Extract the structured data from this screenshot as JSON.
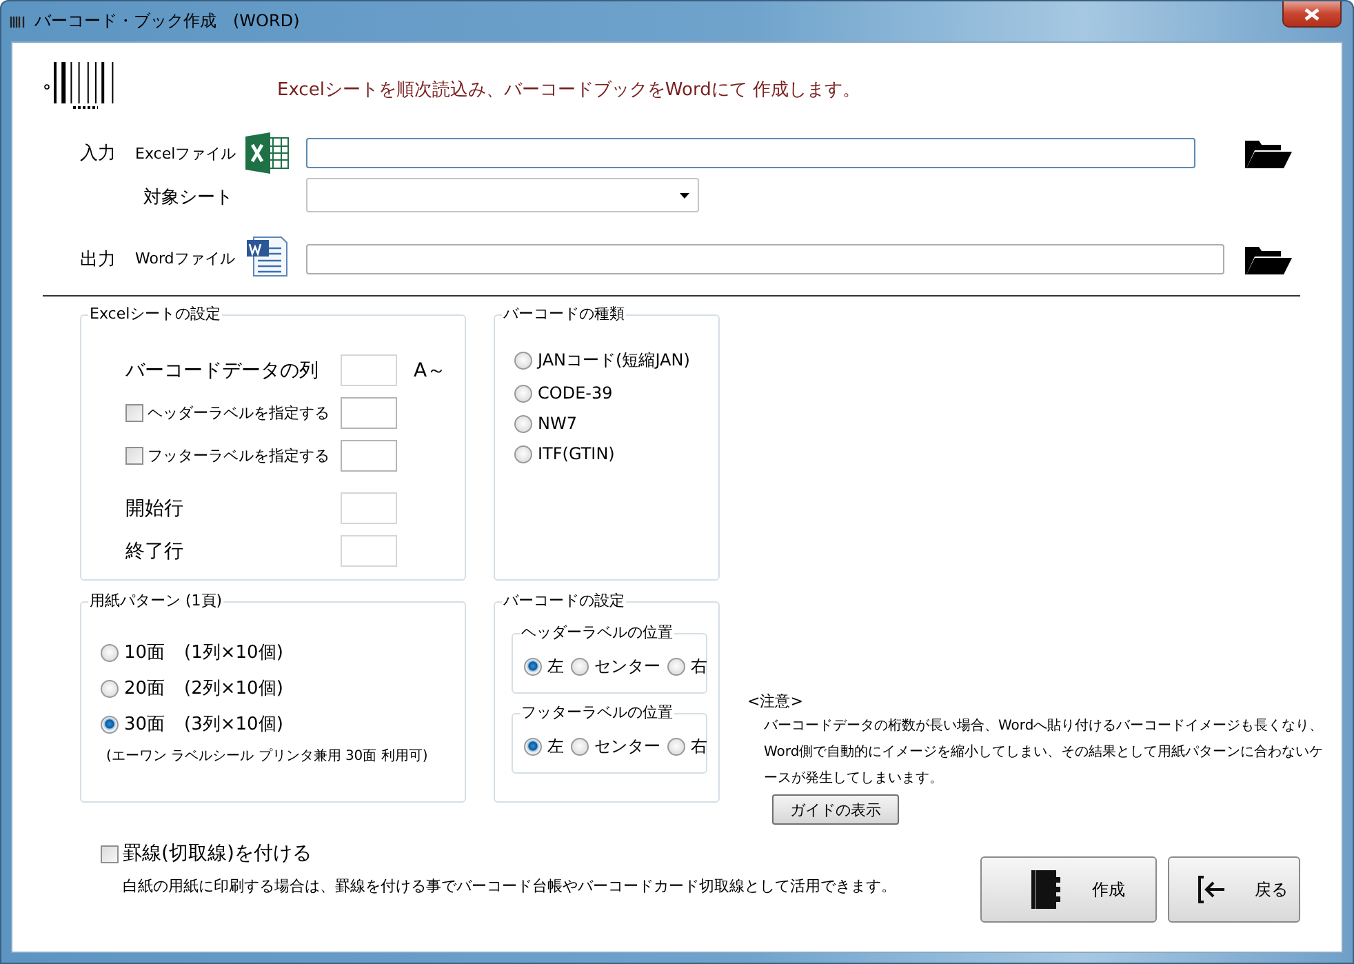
{
  "window": {
    "title": "バーコード・ブック作成　(WORD)"
  },
  "message": "Excelシートを順次読込み、バーコードブックをWordにて 作成します。",
  "input": {
    "label": "入力",
    "excel_file": {
      "label": "Excelファイル"
    },
    "sheet": {
      "label": "対象シート"
    }
  },
  "output": {
    "label": "出力",
    "word_file": {
      "label": "Wordファイル"
    }
  },
  "excel_settings": {
    "title": "Excelシートの設定",
    "rows": [
      {
        "kind": "field",
        "label": "バーコードデータの列",
        "suffix": "A～"
      },
      {
        "kind": "checkbox",
        "label": "ヘッダーラベルを指定する",
        "checked": false
      },
      {
        "kind": "checkbox",
        "label": "フッターラベルを指定する",
        "checked": false
      },
      {
        "kind": "field",
        "label": "開始行"
      },
      {
        "kind": "field",
        "label": "終了行"
      }
    ]
  },
  "barcode_types": {
    "title": "バーコードの種類",
    "options": [
      {
        "label": "JANコード(短縮JAN)",
        "selected": false
      },
      {
        "label": "CODE-39",
        "selected": false
      },
      {
        "label": "NW7",
        "selected": false
      },
      {
        "label": "ITF(GTIN)",
        "selected": false
      }
    ]
  },
  "paper_pattern": {
    "title": "用紙パターン (1頁)",
    "options": [
      {
        "label": "10面",
        "detail": "(1列×10個)",
        "selected": false
      },
      {
        "label": "20面",
        "detail": "(2列×10個)",
        "selected": false
      },
      {
        "label": "30面",
        "detail": "(3列×10個)",
        "selected": true
      }
    ],
    "note": "(エーワン ラベルシール プリンタ兼用 30面 利用可)"
  },
  "barcode_settings": {
    "title": "バーコードの設定",
    "groups": [
      {
        "title": "ヘッダーラベルの位置",
        "options": [
          {
            "label": "左",
            "selected": true
          },
          {
            "label": "センター",
            "selected": false
          },
          {
            "label": "右",
            "selected": false
          }
        ]
      },
      {
        "title": "フッターラベルの位置",
        "options": [
          {
            "label": "左",
            "selected": true
          },
          {
            "label": "センター",
            "selected": false
          },
          {
            "label": "右",
            "selected": false
          }
        ]
      }
    ]
  },
  "notice": {
    "title": "<注意>",
    "text": "バーコードデータの桁数が長い場合、Wordへ貼り付けるバーコードイメージも長くなり、Word側で自動的にイメージを縮小してしまい、その結果として用紙パターンに合わないケースが発生してしまいます。",
    "button": "ガイドの表示"
  },
  "ruled_lines": {
    "label": "罫線(切取線)を付ける",
    "checked": false,
    "note": "白紙の用紙に印刷する場合は、罫線を付ける事でバーコード台帳やバーコードカード切取線として活用できます。"
  },
  "buttons": [
    {
      "kind": "create",
      "label": "作成"
    },
    {
      "kind": "back",
      "label": "戻る"
    }
  ]
}
